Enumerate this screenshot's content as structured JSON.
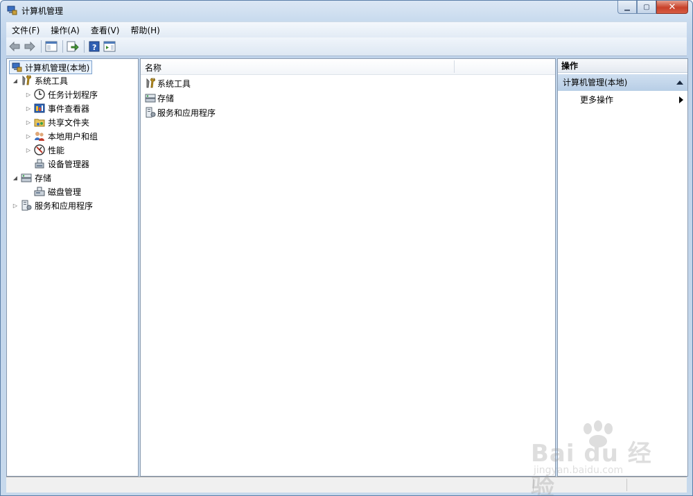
{
  "window": {
    "title": "计算机管理",
    "minimize_icon": "minimize-icon",
    "maximize_icon": "maximize-icon",
    "close_icon": "close-icon"
  },
  "menubar": {
    "items": [
      "文件(F)",
      "操作(A)",
      "查看(V)",
      "帮助(H)"
    ]
  },
  "toolbar": {
    "buttons": [
      "back-arrow-icon",
      "forward-arrow-icon",
      "show-hide-console-tree-icon",
      "export-list-icon",
      "help-icon",
      "show-hide-action-pane-icon"
    ]
  },
  "tree": {
    "root": "计算机管理(本地)",
    "items": [
      {
        "label": "系统工具",
        "expanded": true,
        "icon": "tools-icon"
      },
      {
        "label": "任务计划程序",
        "icon": "clock-icon"
      },
      {
        "label": "事件查看器",
        "icon": "event-viewer-icon"
      },
      {
        "label": "共享文件夹",
        "icon": "shared-folder-icon"
      },
      {
        "label": "本地用户和组",
        "icon": "users-icon"
      },
      {
        "label": "性能",
        "icon": "performance-icon"
      },
      {
        "label": "设备管理器",
        "icon": "device-manager-icon"
      },
      {
        "label": "存储",
        "expanded": true,
        "icon": "storage-icon"
      },
      {
        "label": "磁盘管理",
        "icon": "disk-icon"
      },
      {
        "label": "服务和应用程序",
        "expanded": false,
        "icon": "services-icon"
      }
    ]
  },
  "center": {
    "column_header": "名称",
    "rows": [
      "系统工具",
      "存储",
      "服务和应用程序"
    ]
  },
  "actions": {
    "header": "操作",
    "group_title": "计算机管理(本地)",
    "more_actions": "更多操作"
  },
  "watermark": {
    "brand": "Bai du 经验",
    "url": "jingyan.baidu.com"
  },
  "colors": {
    "selection_border": "#7da2ce",
    "action_group_bg": "#b8cee6",
    "window_frame": "#c9dbee"
  }
}
